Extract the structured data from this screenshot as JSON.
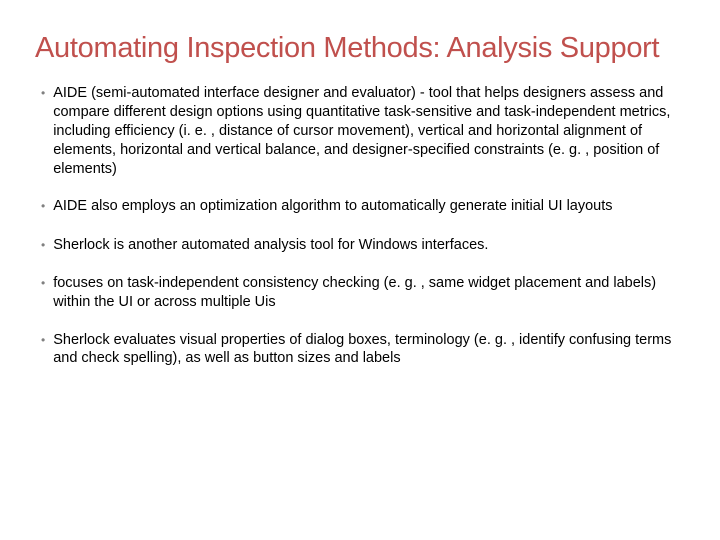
{
  "title": "Automating Inspection Methods: Analysis Support",
  "bullets": [
    "AIDE (semi-automated interface designer and evaluator) - tool that helps designers assess and compare different design options using quantitative task-sensitive and task-independent metrics, including efficiency (i. e. , distance of cursor movement), vertical and horizontal alignment of elements, horizontal and vertical balance, and designer-specified constraints (e. g. , position of elements)",
    "AIDE also employs an optimization algorithm to automatically generate initial UI layouts",
    "Sherlock is another automated analysis tool for Windows interfaces.",
    "focuses on task-independent consistency checking (e. g. , same widget placement and labels) within the UI or across multiple Uis",
    "Sherlock evaluates visual properties of dialog boxes, terminology (e. g. , identify confusing terms and check spelling), as well as button sizes and labels"
  ]
}
